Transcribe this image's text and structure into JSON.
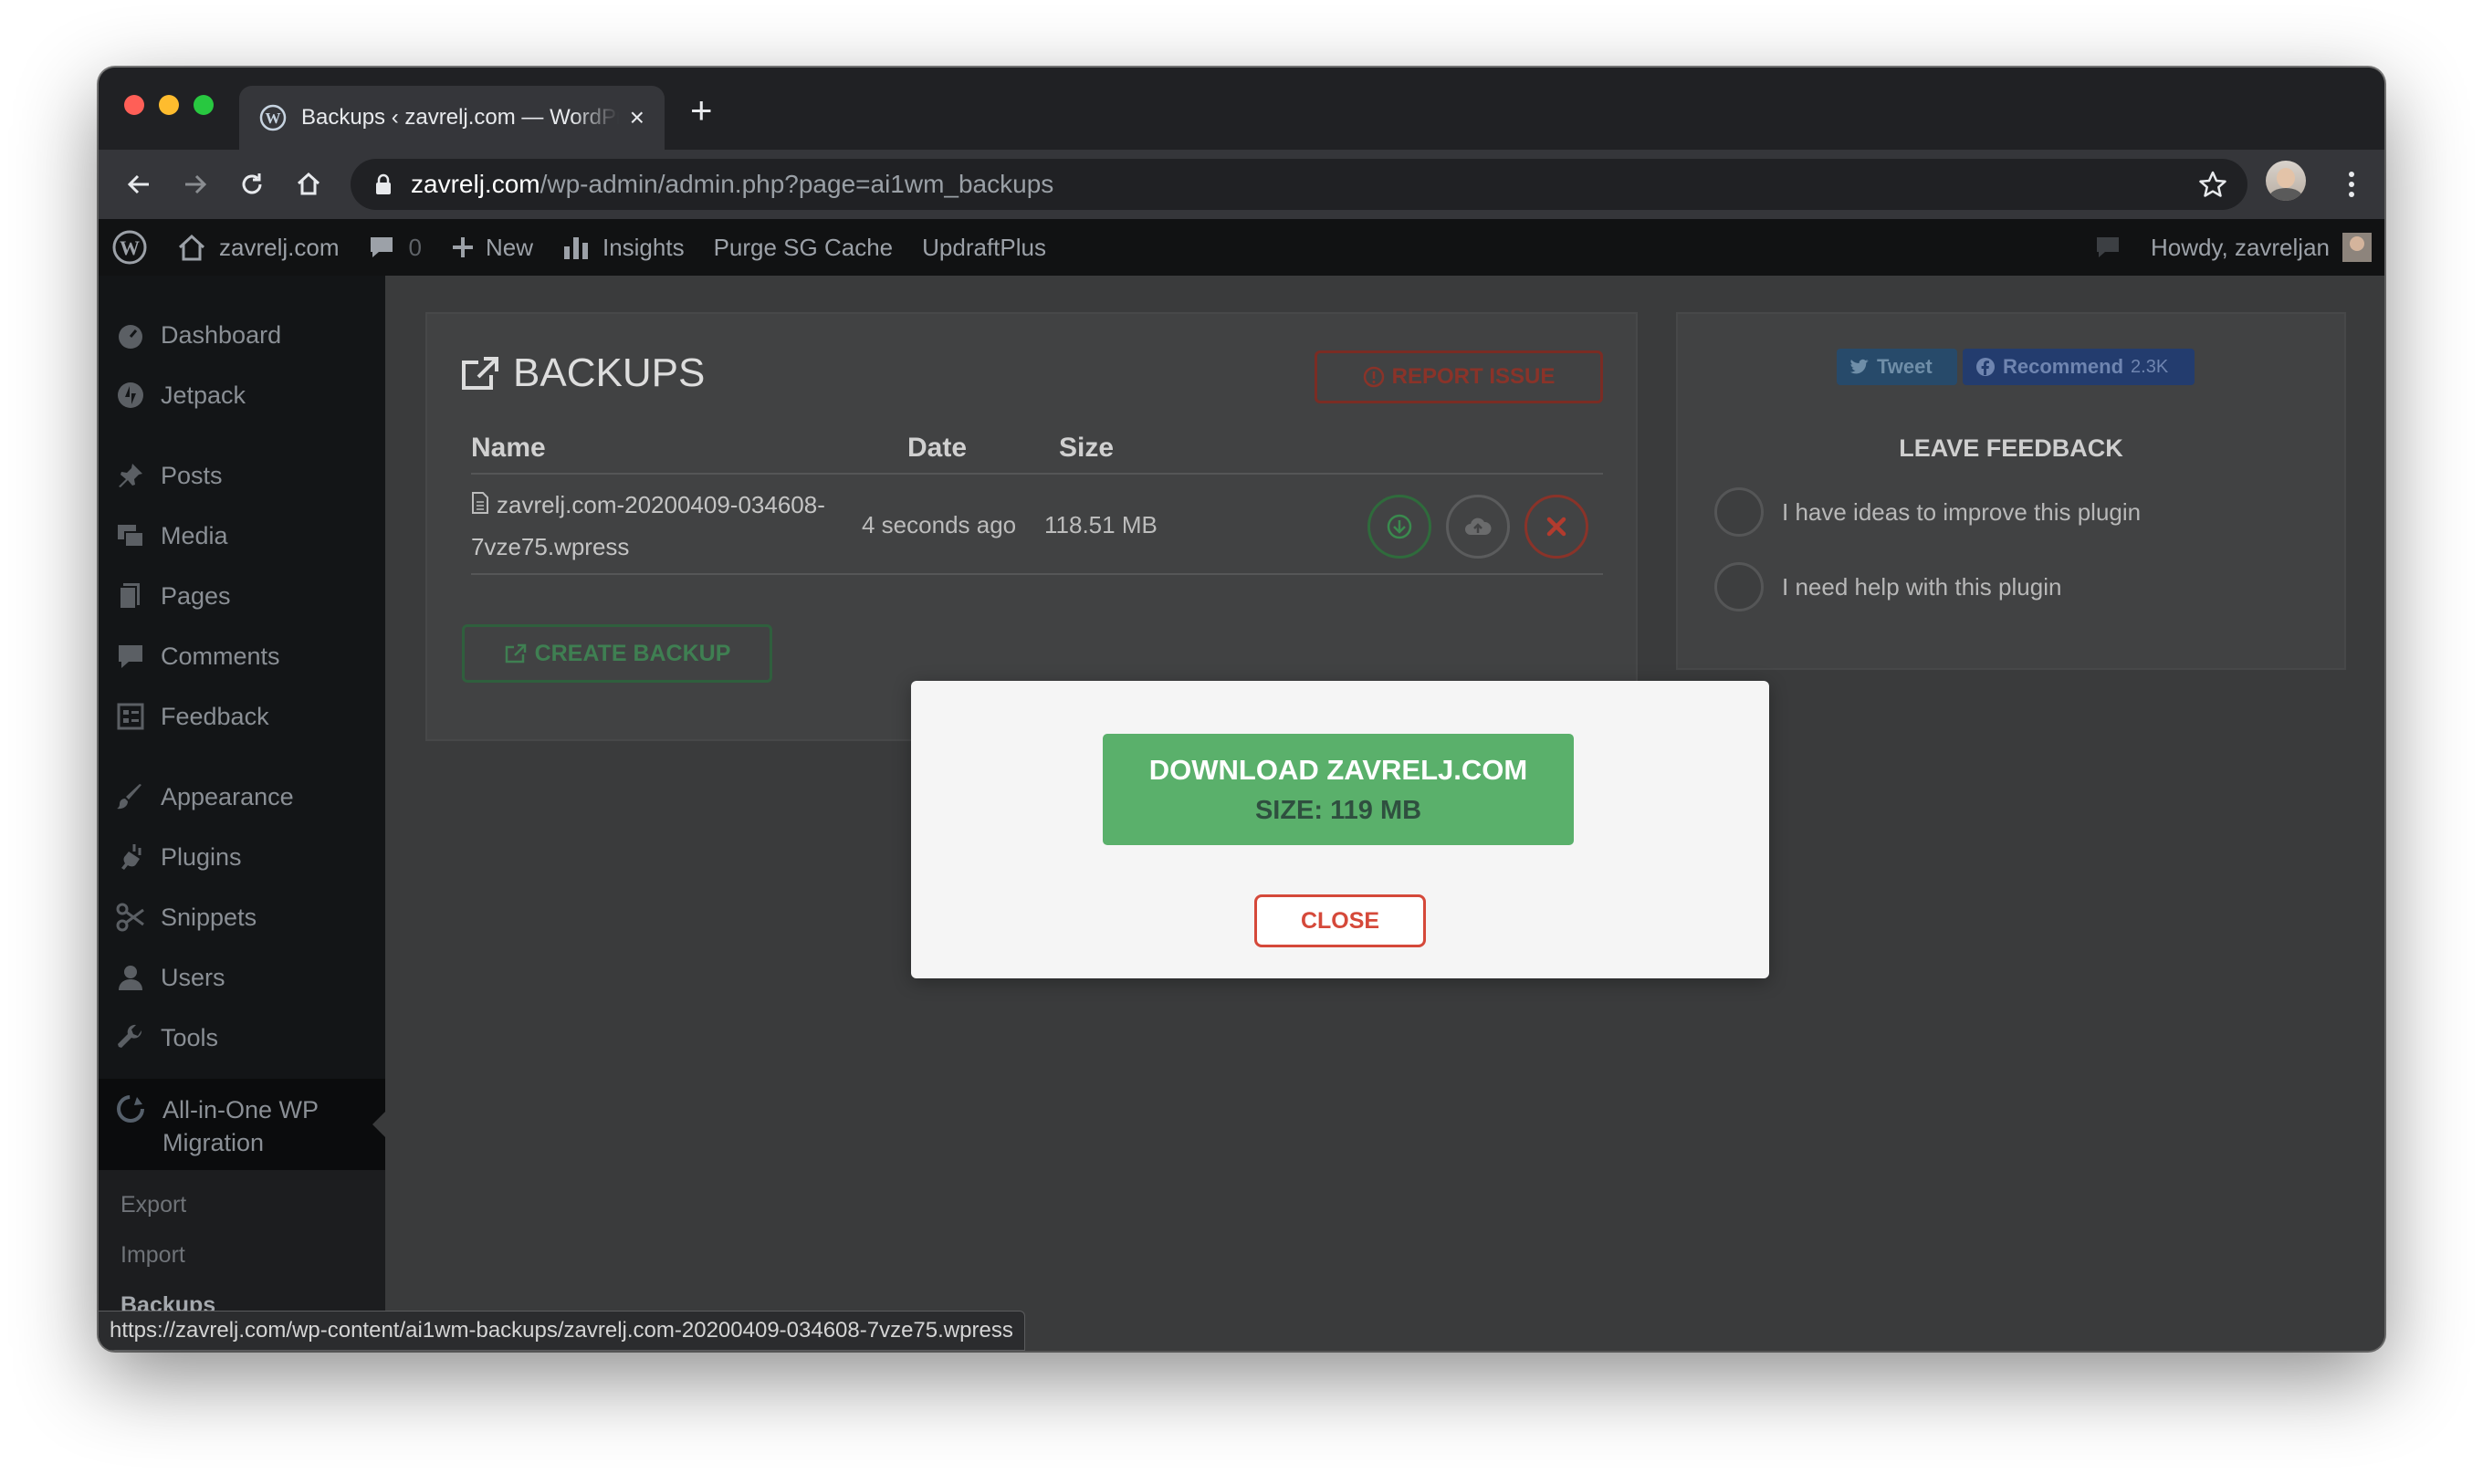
{
  "browser": {
    "tab_title": "Backups ‹ zavrelj.com — WordPress",
    "tab_close": "×",
    "new_tab": "+",
    "url_host": "zavrelj.com",
    "url_path": "/wp-admin/admin.php?page=ai1wm_backups",
    "status_url": "https://zavrelj.com/wp-content/ai1wm-backups/zavrelj.com-20200409-034608-7vze75.wpress"
  },
  "adminbar": {
    "site_name": "zavrelj.com",
    "comments_count": "0",
    "new_label": "New",
    "insights_label": "Insights",
    "purge_label": "Purge SG Cache",
    "updraft_label": "UpdraftPlus",
    "howdy": "Howdy, zavreljan"
  },
  "sidebar": {
    "items": [
      {
        "label": "Dashboard"
      },
      {
        "label": "Jetpack"
      },
      {
        "label": "Posts"
      },
      {
        "label": "Media"
      },
      {
        "label": "Pages"
      },
      {
        "label": "Comments"
      },
      {
        "label": "Feedback"
      },
      {
        "label": "Appearance"
      },
      {
        "label": "Plugins"
      },
      {
        "label": "Snippets"
      },
      {
        "label": "Users"
      },
      {
        "label": "Tools"
      }
    ],
    "current_line1": "All-in-One WP",
    "current_line2": "Migration",
    "submenu": [
      {
        "label": "Export"
      },
      {
        "label": "Import"
      },
      {
        "label": "Backups"
      }
    ]
  },
  "backups": {
    "title": "BACKUPS",
    "report_label": "REPORT ISSUE",
    "columns": {
      "name": "Name",
      "date": "Date",
      "size": "Size"
    },
    "rows": [
      {
        "name_line1": "zavrelj.com-20200409-034608-",
        "name_line2": "7vze75.wpress",
        "date": "4 seconds ago",
        "size": "118.51 MB"
      }
    ],
    "create_label": "CREATE BACKUP"
  },
  "feedback": {
    "tweet_label": "Tweet",
    "recommend_label": "Recommend",
    "recommend_count": "2.3K",
    "heading": "LEAVE FEEDBACK",
    "options": [
      {
        "label": "I have ideas to improve this plugin"
      },
      {
        "label": "I need help with this plugin"
      }
    ]
  },
  "modal": {
    "download_label": "DOWNLOAD ZAVRELJ.COM",
    "size_label": "SIZE: 119 MB",
    "close_label": "CLOSE"
  },
  "colors": {
    "download_green": "#5ab06b",
    "close_red": "#d5493a",
    "admin_bar": "#111213"
  }
}
